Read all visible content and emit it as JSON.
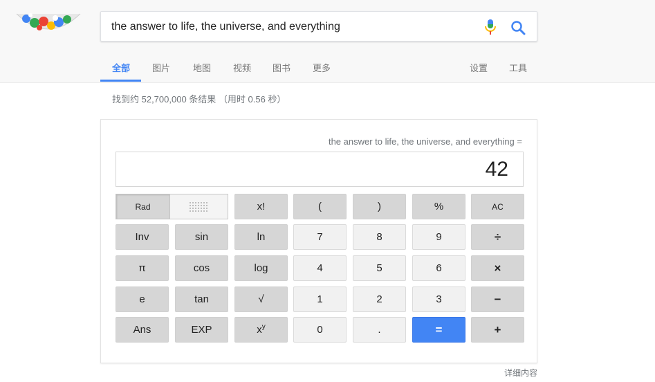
{
  "search": {
    "query": "the answer to life, the universe, and everything"
  },
  "tabs": {
    "all": "全部",
    "images": "图片",
    "maps": "地图",
    "videos": "视频",
    "books": "图书",
    "more": "更多",
    "settings": "设置",
    "tools": "工具"
  },
  "stats": "找到约 52,700,000 条结果 （用时 0.56 秒）",
  "calculator": {
    "expression": "the answer to life, the universe, and everything =",
    "result": "42",
    "rad_label": "Rad",
    "keys": {
      "fact": "x!",
      "lparen": "(",
      "rparen": ")",
      "percent": "%",
      "ac": "AC",
      "inv": "Inv",
      "sin": "sin",
      "ln": "ln",
      "n7": "7",
      "n8": "8",
      "n9": "9",
      "divide": "÷",
      "pi": "π",
      "cos": "cos",
      "log": "log",
      "n4": "4",
      "n5": "5",
      "n6": "6",
      "multiply": "×",
      "e": "e",
      "tan": "tan",
      "sqrt": "√",
      "n1": "1",
      "n2": "2",
      "n3": "3",
      "minus": "−",
      "ans": "Ans",
      "exp": "EXP",
      "pow_base": "x",
      "pow_exp": "y",
      "n0": "0",
      "dot": ".",
      "equals": "=",
      "plus": "+"
    },
    "more_info": "详细内容"
  },
  "colors": {
    "accent": "#4285f4",
    "equals_key": "#4285f4",
    "func_key": "#d6d6d6",
    "num_key": "#f1f1f1"
  },
  "icons": {
    "mic": "microphone-icon",
    "search": "search-icon",
    "degree_toggle": "dots-grid-icon",
    "logo": "doodle-logo"
  }
}
